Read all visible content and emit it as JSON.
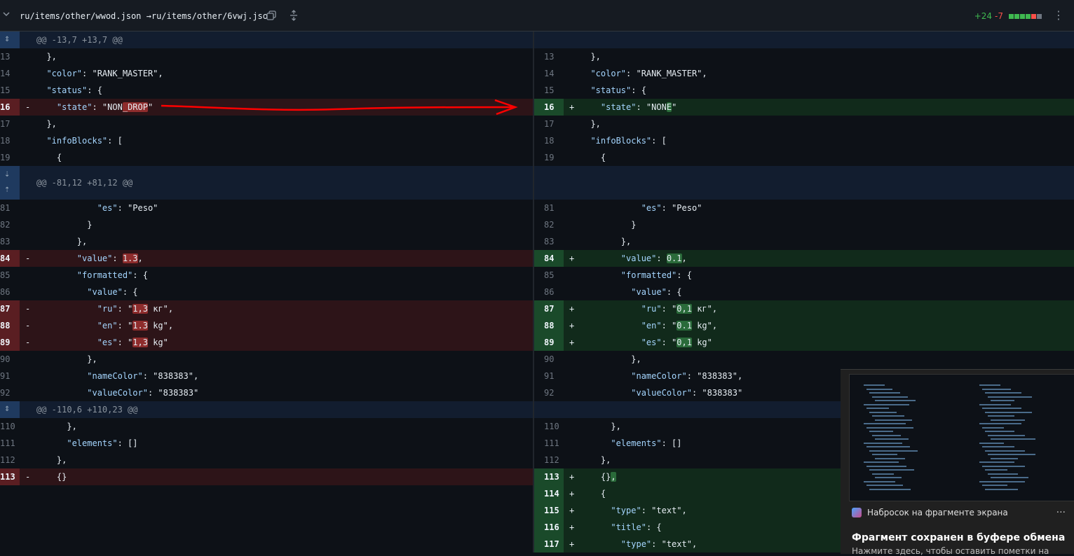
{
  "header": {
    "path": "ru/items/other/wwod.json →ru/items/other/6vwj.json",
    "additions": "+24",
    "deletions": "-7",
    "icons": [
      "chevron-down-icon",
      "copy-icon",
      "expand-icon",
      "kebab-icon"
    ],
    "block_colors": [
      "#3fb950",
      "#3fb950",
      "#3fb950",
      "#3fb950",
      "#f85149",
      "#6e7681"
    ]
  },
  "colors": {
    "added": "#3fb950",
    "deleted": "#f85149",
    "hunk": "#1f3a5f",
    "annotation": "#ff0000"
  },
  "hunks": [
    {
      "header": "@@ -13,7 +13,7 @@",
      "rows": [
        {
          "t": "c",
          "l": "13",
          "r": "13",
          "code": "  },"
        },
        {
          "t": "c",
          "l": "14",
          "r": "14",
          "code": "  \"color\": \"RANK_MASTER\","
        },
        {
          "t": "c",
          "l": "15",
          "r": "15",
          "code": "  \"status\": {"
        },
        {
          "t": "m",
          "l": "16",
          "r": "16",
          "lcode": "    \"state\": \"NON_DROP\"",
          "rcode": "    \"state\": \"NONE\""
        },
        {
          "t": "c",
          "l": "17",
          "r": "17",
          "code": "  },"
        },
        {
          "t": "c",
          "l": "18",
          "r": "18",
          "code": "  \"infoBlocks\": ["
        },
        {
          "t": "c",
          "l": "19",
          "r": "19",
          "code": "    {"
        }
      ]
    },
    {
      "header": "@@ -81,12 +81,12 @@",
      "rows": [
        {
          "t": "c",
          "l": "81",
          "r": "81",
          "code": "            \"es\": \"Peso\""
        },
        {
          "t": "c",
          "l": "82",
          "r": "82",
          "code": "          }"
        },
        {
          "t": "c",
          "l": "83",
          "r": "83",
          "code": "        },"
        },
        {
          "t": "m",
          "l": "84",
          "r": "84",
          "lcode": "        \"value\": 1.3,",
          "rcode": "        \"value\": 0.1,"
        },
        {
          "t": "c",
          "l": "85",
          "r": "85",
          "code": "        \"formatted\": {"
        },
        {
          "t": "c",
          "l": "86",
          "r": "86",
          "code": "          \"value\": {"
        },
        {
          "t": "m",
          "l": "87",
          "r": "87",
          "lcode": "            \"ru\": \"1,3 кг\",",
          "rcode": "            \"ru\": \"0,1 кг\","
        },
        {
          "t": "m",
          "l": "88",
          "r": "88",
          "lcode": "            \"en\": \"1.3 kg\",",
          "rcode": "            \"en\": \"0.1 kg\","
        },
        {
          "t": "m",
          "l": "89",
          "r": "89",
          "lcode": "            \"es\": \"1,3 kg\"",
          "rcode": "            \"es\": \"0,1 kg\""
        },
        {
          "t": "c",
          "l": "90",
          "r": "90",
          "code": "          },"
        },
        {
          "t": "c",
          "l": "91",
          "r": "91",
          "code": "          \"nameColor\": \"838383\","
        },
        {
          "t": "c",
          "l": "92",
          "r": "92",
          "code": "          \"valueColor\": \"838383\""
        }
      ]
    },
    {
      "header": "@@ -110,6 +110,23 @@",
      "rows": [
        {
          "t": "c",
          "l": "110",
          "r": "110",
          "code": "      },"
        },
        {
          "t": "c",
          "l": "111",
          "r": "111",
          "code": "      \"elements\": []"
        },
        {
          "t": "c",
          "l": "112",
          "r": "112",
          "code": "    },"
        },
        {
          "t": "m",
          "l": "113",
          "r": "113",
          "lcode": "    {}",
          "rcode": "    {},"
        },
        {
          "t": "a",
          "r": "114",
          "rcode": "    {"
        },
        {
          "t": "a",
          "r": "115",
          "rcode": "      \"type\": \"text\","
        },
        {
          "t": "a",
          "r": "116",
          "rcode": "      \"title\": {"
        },
        {
          "t": "a",
          "r": "117",
          "rcode": "        \"type\": \"text\","
        }
      ]
    }
  ],
  "toast": {
    "app": "Набросок на фрагменте экрана",
    "more": "···",
    "title": "Фрагмент сохранен в буфере обмена",
    "body": "Нажмите здесь, чтобы оставить пометки на"
  }
}
